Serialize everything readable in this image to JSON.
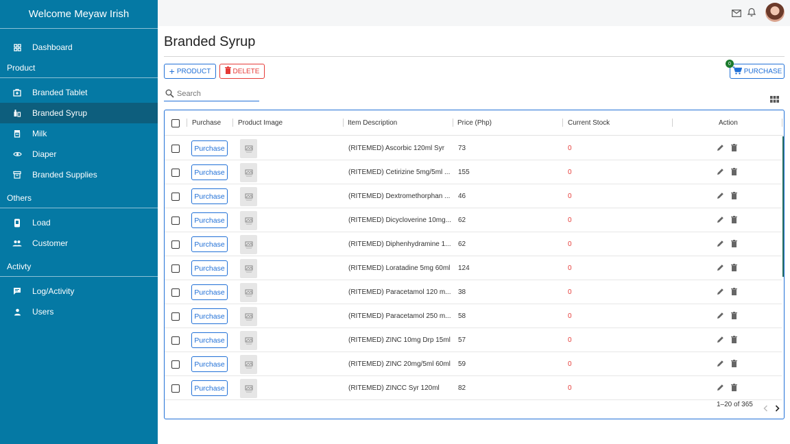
{
  "sidebar": {
    "welcome": "Welcome  Meyaw Irish",
    "dashboard": {
      "label": "Dashboard",
      "icon": "dashboard-icon"
    },
    "sections": [
      {
        "title": "Product",
        "items": [
          {
            "label": "Branded Tablet",
            "icon": "medical-bag-icon"
          },
          {
            "label": "Branded Syrup",
            "icon": "syrup-bottle-icon",
            "active": true
          },
          {
            "label": "Milk",
            "icon": "milk-jar-icon"
          },
          {
            "label": "Diaper",
            "icon": "eye-icon"
          },
          {
            "label": "Branded Supplies",
            "icon": "archive-box-icon"
          }
        ]
      },
      {
        "title": "Others",
        "items": [
          {
            "label": "Load",
            "icon": "mobile-phone-icon"
          },
          {
            "label": "Customer",
            "icon": "people-icon"
          }
        ]
      },
      {
        "title": "Activty",
        "items": [
          {
            "label": "Log/Activity",
            "icon": "log-icon"
          },
          {
            "label": "Users",
            "icon": "user-icon"
          }
        ]
      }
    ]
  },
  "topbar": {
    "icons": [
      "mail-icon",
      "bell-icon",
      "avatar"
    ]
  },
  "page": {
    "title": "Branded Syrup"
  },
  "toolbar": {
    "add_product_label": "PRODUCT",
    "delete_label": "DELETE",
    "purchase_label": "PURCHASE",
    "cart_count": "0"
  },
  "search": {
    "placeholder": "Search",
    "value": ""
  },
  "table": {
    "columns": [
      "Purchase",
      "Product Image",
      "Item Description",
      "Price (Php)",
      "Current Stock",
      "Action"
    ],
    "purchase_button_label": "Purchase",
    "rows": [
      {
        "description": "(RITEMED) Ascorbic 120ml Syr",
        "price": "73",
        "stock": "0"
      },
      {
        "description": "(RITEMED) Cetirizine 5mg/5ml ...",
        "price": "155",
        "stock": "0"
      },
      {
        "description": "(RITEMED) Dextromethorphan ...",
        "price": "46",
        "stock": "0"
      },
      {
        "description": "(RITEMED) Dicycloverine 10mg...",
        "price": "62",
        "stock": "0"
      },
      {
        "description": "(RITEMED) Diphenhydramine 1...",
        "price": "62",
        "stock": "0"
      },
      {
        "description": "(RITEMED) Loratadine 5mg 60ml",
        "price": "124",
        "stock": "0"
      },
      {
        "description": "(RITEMED) Paracetamol 120 m...",
        "price": "38",
        "stock": "0"
      },
      {
        "description": "(RITEMED) Paracetamol 250 m...",
        "price": "58",
        "stock": "0"
      },
      {
        "description": "(RITEMED) ZINC 10mg Drp 15ml",
        "price": "57",
        "stock": "0"
      },
      {
        "description": "(RITEMED) ZINC 20mg/5ml 60ml",
        "price": "59",
        "stock": "0"
      },
      {
        "description": "(RITEMED) ZINCC Syr 120ml",
        "price": "82",
        "stock": "0"
      }
    ],
    "pagination": "1–20 of 365"
  },
  "colors": {
    "sidebar": "#0579a4",
    "sidebar_active": "#0d5e7d",
    "primary": "#1f6fd6",
    "danger": "#e53935",
    "badge": "#1b7a2d"
  }
}
